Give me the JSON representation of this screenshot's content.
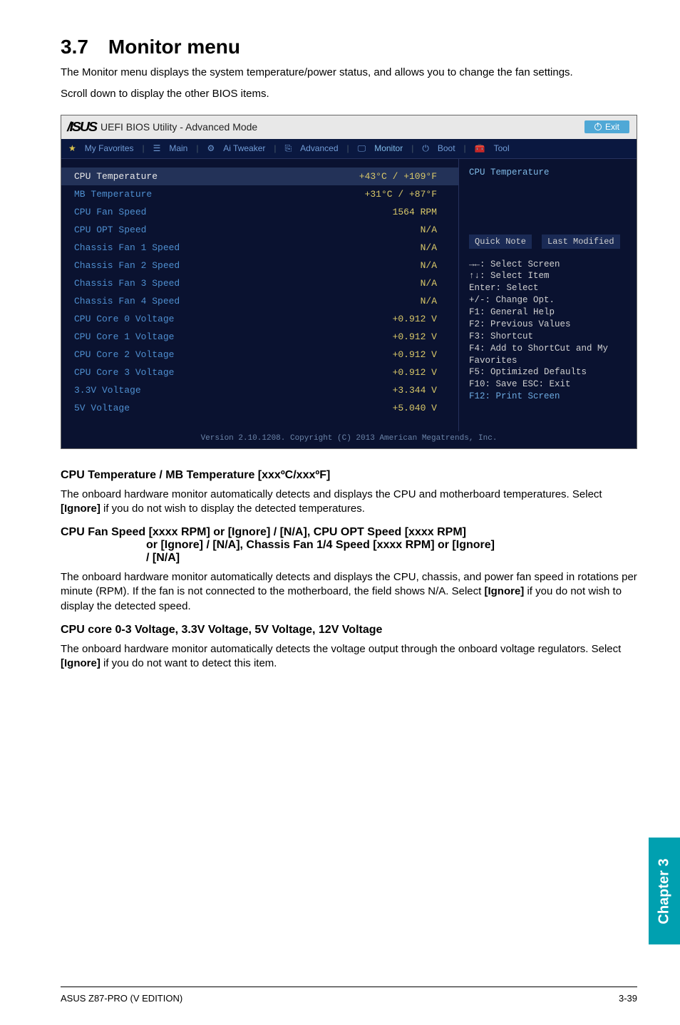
{
  "heading": "3.7 Monitor menu",
  "intro1": "The Monitor menu displays the system temperature/power status, and allows you to change the fan settings.",
  "intro2": "Scroll down to display the other BIOS items.",
  "bios": {
    "titlebar": {
      "util": "UEFI BIOS Utility - Advanced Mode",
      "exit": "Exit"
    },
    "tabs": {
      "fav": "My Favorites",
      "main": "Main",
      "aituner": "Ai Tweaker",
      "adv": "Advanced",
      "monitor": "Monitor",
      "boot": "Boot",
      "tool": "Tool"
    },
    "rows": [
      {
        "label": "CPU Temperature",
        "val": "+43°C / +109°F",
        "selected": true
      },
      {
        "label": "MB Temperature",
        "val": "+31°C / +87°F"
      },
      {
        "label": "CPU Fan Speed",
        "val": "1564 RPM"
      },
      {
        "label": "CPU OPT Speed",
        "val": "N/A"
      },
      {
        "label": "Chassis Fan 1 Speed",
        "val": "N/A"
      },
      {
        "label": "Chassis Fan 2 Speed",
        "val": "N/A"
      },
      {
        "label": "Chassis Fan 3 Speed",
        "val": "N/A"
      },
      {
        "label": "Chassis Fan 4 Speed",
        "val": "N/A"
      },
      {
        "label": "CPU Core 0 Voltage",
        "val": "+0.912 V"
      },
      {
        "label": "CPU Core 1 Voltage",
        "val": "+0.912 V"
      },
      {
        "label": "CPU Core 2 Voltage",
        "val": "+0.912 V"
      },
      {
        "label": "CPU Core 3 Voltage",
        "val": "+0.912 V"
      },
      {
        "label": "3.3V Voltage",
        "val": "+3.344 V"
      },
      {
        "label": "5V Voltage",
        "val": "+5.040 V"
      }
    ],
    "right": {
      "head": "CPU Temperature",
      "quick": "Quick Note",
      "last": "Last Modified",
      "help": {
        "l1": "→←: Select Screen",
        "l2": "↑↓: Select Item",
        "l3": "Enter: Select",
        "l4": "+/-: Change Opt.",
        "l5": "F1: General Help",
        "l6": "F2: Previous Values",
        "l7": "F3: Shortcut",
        "l8": "F4: Add to ShortCut and My Favorites",
        "l9": "F5: Optimized Defaults",
        "l10": "F10: Save  ESC: Exit",
        "l11": "F12: Print Screen"
      }
    },
    "footer": "Version 2.10.1208. Copyright (C) 2013 American Megatrends, Inc."
  },
  "sec1": {
    "h": "CPU Temperature / MB Temperature [xxxºC/xxxºF]",
    "p1a": "The onboard hardware monitor automatically detects and displays the CPU and motherboard temperatures. Select ",
    "p1b": "[Ignore]",
    "p1c": " if you do not wish to display the detected temperatures."
  },
  "sec2": {
    "h1": "CPU Fan Speed [xxxx RPM] or [Ignore] / [N/A], CPU OPT Speed [xxxx RPM]",
    "h2": "or [Ignore] / [N/A], Chassis Fan 1/4 Speed [xxxx RPM] or [Ignore]",
    "h3": "/ [N/A]",
    "p1a": "The onboard hardware monitor automatically detects and displays the CPU, chassis, and power fan speed in rotations per minute (RPM). If the fan is not connected to the motherboard, the field shows N/A. Select ",
    "p1b": "[Ignore]",
    "p1c": " if you do not wish to display the detected speed."
  },
  "sec3": {
    "h": "CPU core 0-3 Voltage, 3.3V Voltage, 5V Voltage, 12V Voltage",
    "p1a": "The onboard hardware monitor automatically detects the voltage output through the onboard voltage regulators. Select ",
    "p1b": "[Ignore]",
    "p1c": " if you do not want to detect this item."
  },
  "sidetab": "Chapter 3",
  "footer": {
    "left": "ASUS Z87-PRO (V EDITION)",
    "right": "3-39"
  }
}
